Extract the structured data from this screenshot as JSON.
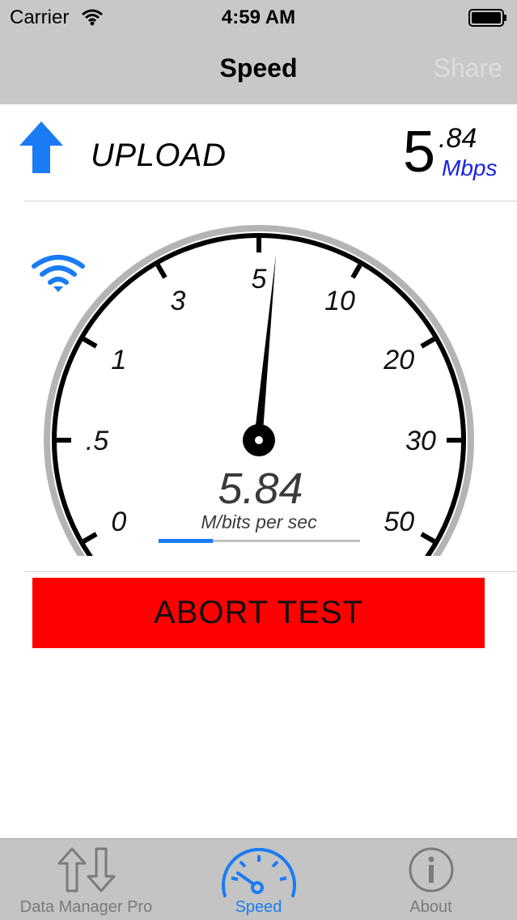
{
  "status_bar": {
    "carrier": "Carrier",
    "time": "4:59 AM"
  },
  "nav": {
    "title": "Speed",
    "share_label": "Share"
  },
  "test": {
    "direction_label": "UPLOAD",
    "speed_whole": "5",
    "speed_fraction": ".84",
    "unit": "Mbps"
  },
  "gauge": {
    "value_text": "5.84",
    "units_text": "M/bits per sec",
    "scale_labels": [
      "0",
      ".5",
      "1",
      "3",
      "5",
      "10",
      "20",
      "30",
      "50"
    ],
    "needle_value": 5.84,
    "progress_fraction": 0.27
  },
  "actions": {
    "abort_label": "ABORT TEST"
  },
  "tab_bar": {
    "items": [
      {
        "label": "Data Manager Pro",
        "icon": "updown-arrows-icon",
        "active": false
      },
      {
        "label": "Speed",
        "icon": "speedometer-icon",
        "active": true
      },
      {
        "label": "About",
        "icon": "info-circle-icon",
        "active": false
      }
    ]
  },
  "colors": {
    "accent_blue": "#1a7cf5",
    "unit_blue": "#1a20e8",
    "abort_red": "#ff0000",
    "bar_gray": "#c8c8c8"
  }
}
